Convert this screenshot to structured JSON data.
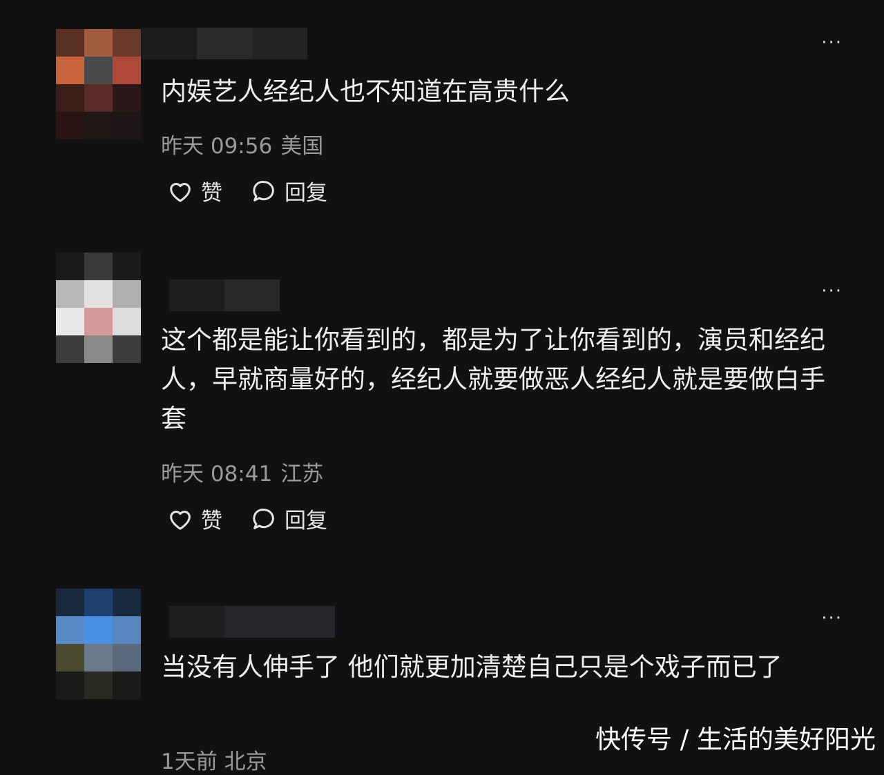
{
  "comments": [
    {
      "text": "内娱艺人经纪人也不知道在高贵什么",
      "time": "昨天 09:56",
      "location": "美国",
      "like_label": "赞",
      "reply_label": "回复",
      "more_label": "···",
      "avatar_colors": [
        "#5a3024",
        "#a25a40",
        "#6a3a2a",
        "#c9643d",
        "#4a4a4a",
        "#b0483a",
        "#3a1c18",
        "#5a2a28",
        "#2a1818",
        "#2a1414",
        "#201616",
        "#1e1616"
      ]
    },
    {
      "text": "这个都是能让你看到的，都是为了让你看到的，演员和经纪人，早就商量好的，经纪人就要做恶人经纪人就是要做白手套",
      "time": "昨天 08:41",
      "location": "江苏",
      "like_label": "赞",
      "reply_label": "回复",
      "more_label": "···",
      "avatar_colors": [
        "#1a1a1c",
        "#3a3a3c",
        "#1a1a1c",
        "#b8b8ba",
        "#e2e2e4",
        "#b0b0b2",
        "#e8e8ea",
        "#d49a9a",
        "#dcdcde",
        "#3c3c3e",
        "#8a8a8c",
        "#3c3c3e"
      ]
    },
    {
      "text": "当没有人伸手了 他们就更加清楚自己只是个戏子而已了",
      "time": "1天前",
      "location": "北京",
      "more_label": "···",
      "avatar_colors": [
        "#1a2a3e",
        "#1e3f70",
        "#1a2a3e",
        "#5a8ac8",
        "#4a90e0",
        "#5a86c0",
        "#4a4a30",
        "#6a7a88",
        "#5a6a7c",
        "#1a1a18",
        "#2a2a22",
        "#1a1a18"
      ]
    }
  ],
  "watermark": "快传号 / 生活的美好阳光"
}
